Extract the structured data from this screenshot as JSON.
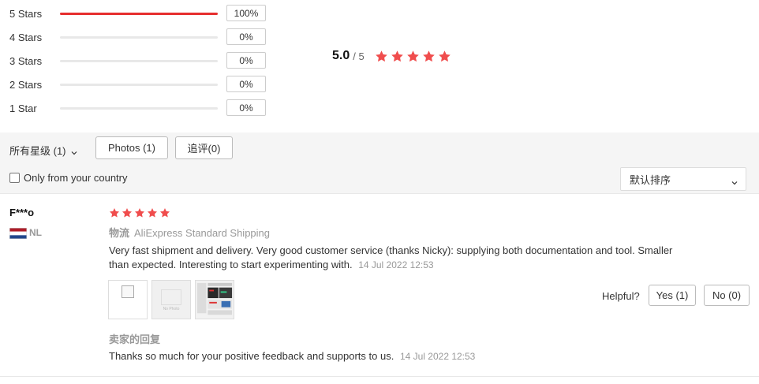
{
  "rating_breakdown": [
    {
      "label": "5 Stars",
      "percent": 100,
      "percent_text": "100%"
    },
    {
      "label": "4 Stars",
      "percent": 0,
      "percent_text": "0%"
    },
    {
      "label": "3 Stars",
      "percent": 0,
      "percent_text": "0%"
    },
    {
      "label": "2 Stars",
      "percent": 0,
      "percent_text": "0%"
    },
    {
      "label": "1 Star",
      "percent": 0,
      "percent_text": "0%"
    }
  ],
  "summary": {
    "score": "5.0",
    "total": "/ 5",
    "stars": 5
  },
  "filters": {
    "star_filter_label": "所有星级 (1)",
    "photos_label": "Photos (1)",
    "followup_label": "追评(0)",
    "country_label": "Only from your country",
    "country_checked": false,
    "sort_label": "默认排序"
  },
  "review": {
    "reviewer": "F***o",
    "country_code": "NL",
    "stars": 5,
    "shipping_label": "物流",
    "shipping_method": "AliExpress Standard Shipping",
    "text": "Very fast shipment and delivery. Very good customer service (thanks Nicky): supplying both documentation and tool. Smaller than expected. Interesting to start experimenting with.",
    "date": "14 Jul 2022 12:53",
    "nophoto_text": "No Photo",
    "helpful_label": "Helpful?",
    "yes_label": "Yes (1)",
    "no_label": "No (0)",
    "seller_reply_title": "卖家的回复",
    "seller_reply_text": "Thanks so much for your positive feedback and supports to us.",
    "seller_reply_date": "14 Jul 2022 12:53"
  },
  "colors": {
    "accent": "#e62e2e",
    "star": "#f04d4d",
    "muted": "#999999"
  }
}
